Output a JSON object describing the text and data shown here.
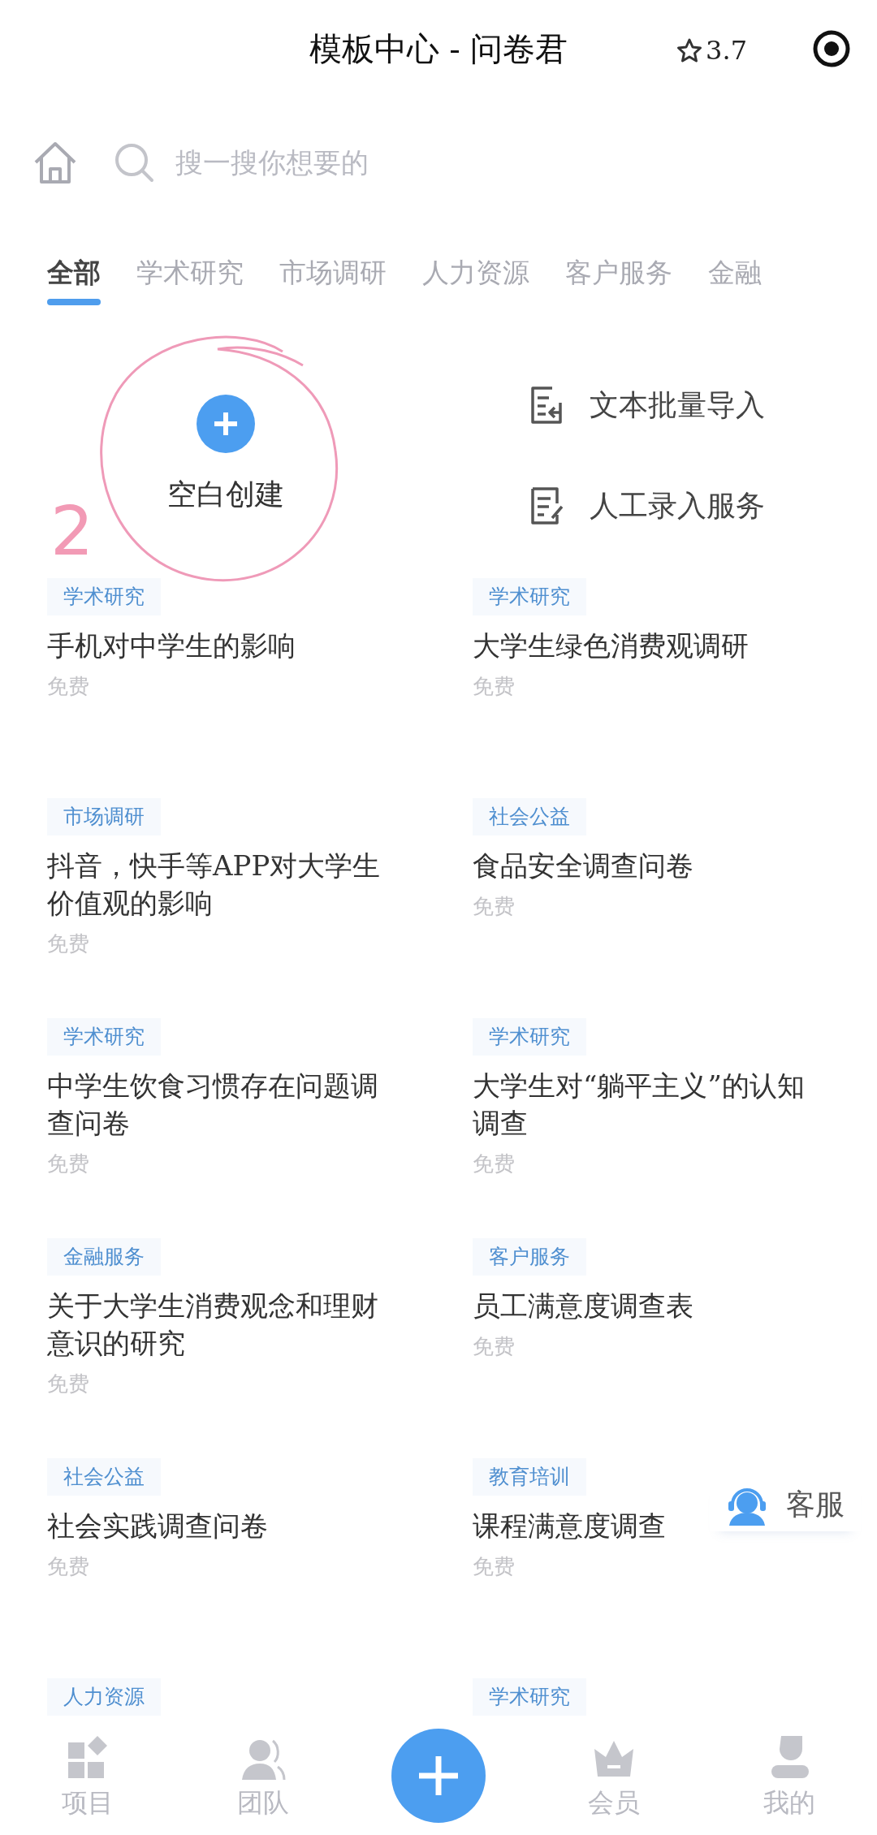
{
  "header": {
    "title": "模板中心 - 问卷君",
    "rating": "3.7"
  },
  "search": {
    "placeholder": "搜一搜你想要的"
  },
  "tabs": [
    {
      "label": "全部",
      "selected": true
    },
    {
      "label": "学术研究",
      "selected": false
    },
    {
      "label": "市场调研",
      "selected": false
    },
    {
      "label": "人力资源",
      "selected": false
    },
    {
      "label": "客户服务",
      "selected": false
    },
    {
      "label": "金融",
      "selected": false
    }
  ],
  "create": {
    "label": "空白创建",
    "annotation": "2"
  },
  "actions": [
    {
      "kind": "import",
      "label": "文本批量导入"
    },
    {
      "kind": "manual",
      "label": "人工录入服务"
    }
  ],
  "templates": [
    {
      "tag": "学术研究",
      "title": "手机对中学生的影响",
      "price": "免费"
    },
    {
      "tag": "学术研究",
      "title": "大学生绿色消费观调研",
      "price": "免费"
    },
    {
      "tag": "市场调研",
      "title": "抖音，快手等APP对大学生价值观的影响",
      "price": "免费"
    },
    {
      "tag": "社会公益",
      "title": "食品安全调查问卷",
      "price": "免费"
    },
    {
      "tag": "学术研究",
      "title": "中学生饮食习惯存在问题调查问卷",
      "price": "免费"
    },
    {
      "tag": "学术研究",
      "title": "大学生对“躺平主义”的认知调查",
      "price": "免费"
    },
    {
      "tag": "金融服务",
      "title": "关于大学生消费观念和理财意识的研究",
      "price": "免费"
    },
    {
      "tag": "客户服务",
      "title": "员工满意度调查表",
      "price": "免费"
    },
    {
      "tag": "社会公益",
      "title": "社会实践调查问卷",
      "price": "免费"
    },
    {
      "tag": "教育培训",
      "title": "课程满意度调查",
      "price": "免费"
    },
    {
      "tag": "人力资源"
    },
    {
      "tag": "学术研究"
    }
  ],
  "support": {
    "label": "客服"
  },
  "bottom_nav": [
    {
      "kind": "grid",
      "label": "项目"
    },
    {
      "kind": "team",
      "label": "团队"
    },
    {
      "kind": "add"
    },
    {
      "kind": "crown",
      "label": "会员"
    },
    {
      "kind": "user",
      "label": "我的"
    }
  ]
}
